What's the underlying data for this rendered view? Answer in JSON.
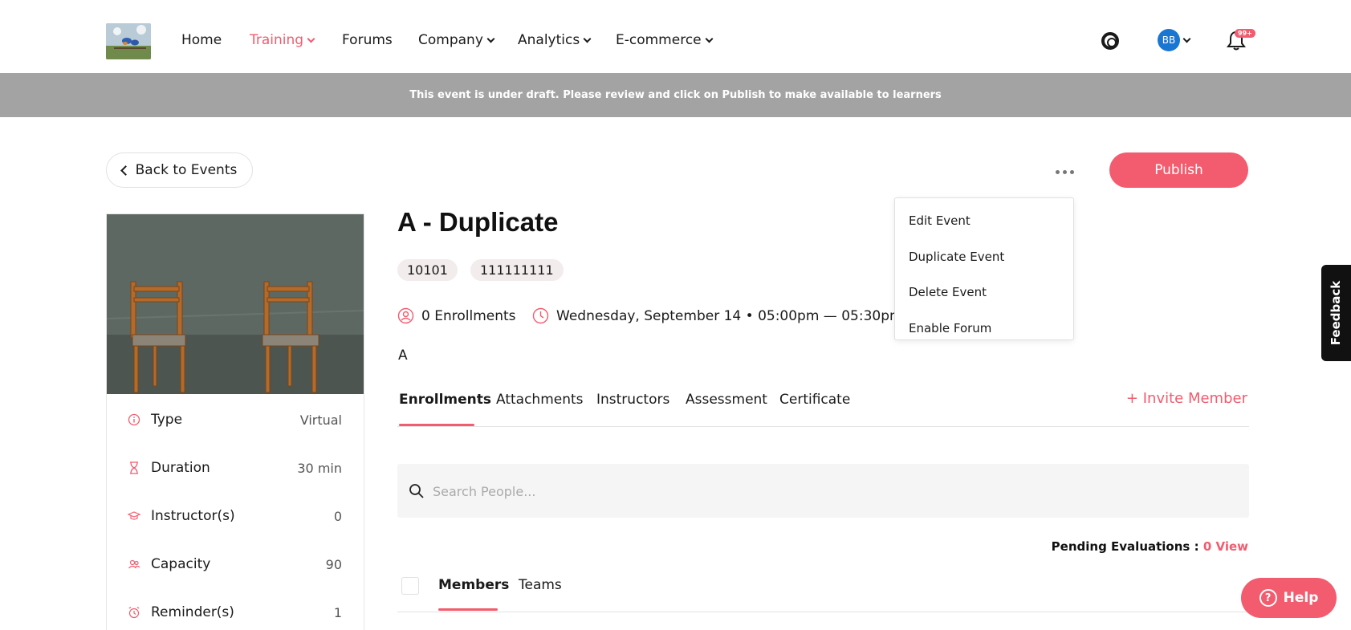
{
  "nav": {
    "items": [
      {
        "label": "Home",
        "active": false,
        "dropdown": false
      },
      {
        "label": "Training",
        "active": true,
        "dropdown": true
      },
      {
        "label": "Forums",
        "active": false,
        "dropdown": false
      },
      {
        "label": "Company",
        "active": false,
        "dropdown": true
      },
      {
        "label": "Analytics",
        "active": false,
        "dropdown": true
      },
      {
        "label": "E-commerce",
        "active": false,
        "dropdown": true
      }
    ],
    "avatar_initials": "BB",
    "notification_badge": "99+"
  },
  "banner": {
    "text": "This event is under draft. Please review and click on Publish to make available to learners"
  },
  "toolbar": {
    "back_label": "Back to Events",
    "publish_label": "Publish",
    "more_menu": [
      "Edit Event",
      "Duplicate Event",
      "Delete Event",
      "Enable Forum"
    ]
  },
  "details": {
    "rows": [
      {
        "icon": "info-icon",
        "label": "Type",
        "value": "Virtual"
      },
      {
        "icon": "hourglass-icon",
        "label": "Duration",
        "value": "30 min"
      },
      {
        "icon": "graduation-cap-icon",
        "label": "Instructor(s)",
        "value": "0"
      },
      {
        "icon": "people-icon",
        "label": "Capacity",
        "value": "90"
      },
      {
        "icon": "alarm-icon",
        "label": "Reminder(s)",
        "value": "1"
      }
    ]
  },
  "event": {
    "title": "A - Duplicate",
    "tags": [
      "10101",
      "111111111"
    ],
    "enrollments": "0 Enrollments",
    "datetime": "Wednesday, September 14 • 05:00pm — 05:30pm",
    "description": "A"
  },
  "tabs": {
    "items": [
      "Enrollments",
      "Attachments",
      "Instructors",
      "Assessment",
      "Certificate"
    ],
    "active": "Enrollments",
    "invite_label": "+ Invite Member"
  },
  "search": {
    "placeholder": "Search People..."
  },
  "pending": {
    "label": "Pending Evaluations :",
    "value": "0 View"
  },
  "subtabs": {
    "items": [
      "Members",
      "Teams"
    ],
    "active": "Members"
  },
  "feedback_label": "Feedback",
  "help_label": "Help",
  "colors": {
    "accent": "#f25c6e",
    "banner": "#a3a3a3",
    "avatar": "#1976d2"
  }
}
